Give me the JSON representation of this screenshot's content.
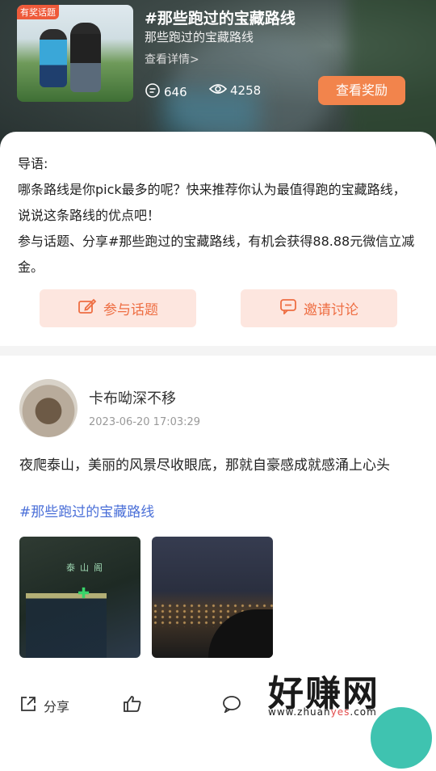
{
  "header": {
    "cover_badge": "有奖话题",
    "title": "#那些跑过的宝藏路线",
    "subtitle": "那些跑过的宝藏路线",
    "detail_link": "查看详情>",
    "comment_count": "646",
    "view_count": "4258",
    "reward_button": "查看奖励"
  },
  "intro": {
    "lines": [
      "导语:",
      "哪条路线是你pick最多的呢？快来推荐你认为最值得跑的宝藏路线，说说这条路线的优点吧！",
      "参与话题、分享#那些跑过的宝藏路线，有机会获得88.88元微信立减金。"
    ]
  },
  "actions": {
    "join": "参与话题",
    "invite": "邀请讨论"
  },
  "post": {
    "username": "卡布呦深不移",
    "timestamp": "2023-06-20 17:03:29",
    "text": "夜爬泰山，美丽的风景尽收眼底，那就自豪感成就感涌上心头",
    "hashtag": "#那些跑过的宝藏路线",
    "photo1_sign": "泰山阁"
  },
  "bottom": {
    "share": "分享"
  },
  "watermark": {
    "big": "好赚网",
    "url_a": "www.zhuan",
    "url_b": "yes",
    "url_c": ".com"
  },
  "icons": {
    "comment": "comment-icon",
    "eye": "eye-icon",
    "edit": "edit-icon",
    "chat": "chat-icon",
    "share": "share-icon",
    "like": "thumbs-up-icon",
    "bubble": "speech-bubble-icon"
  },
  "colors": {
    "accent_orange": "#f2844c",
    "action_bg": "#fde6df",
    "action_text": "#ee6e43",
    "hashtag": "#4a6fd8"
  }
}
